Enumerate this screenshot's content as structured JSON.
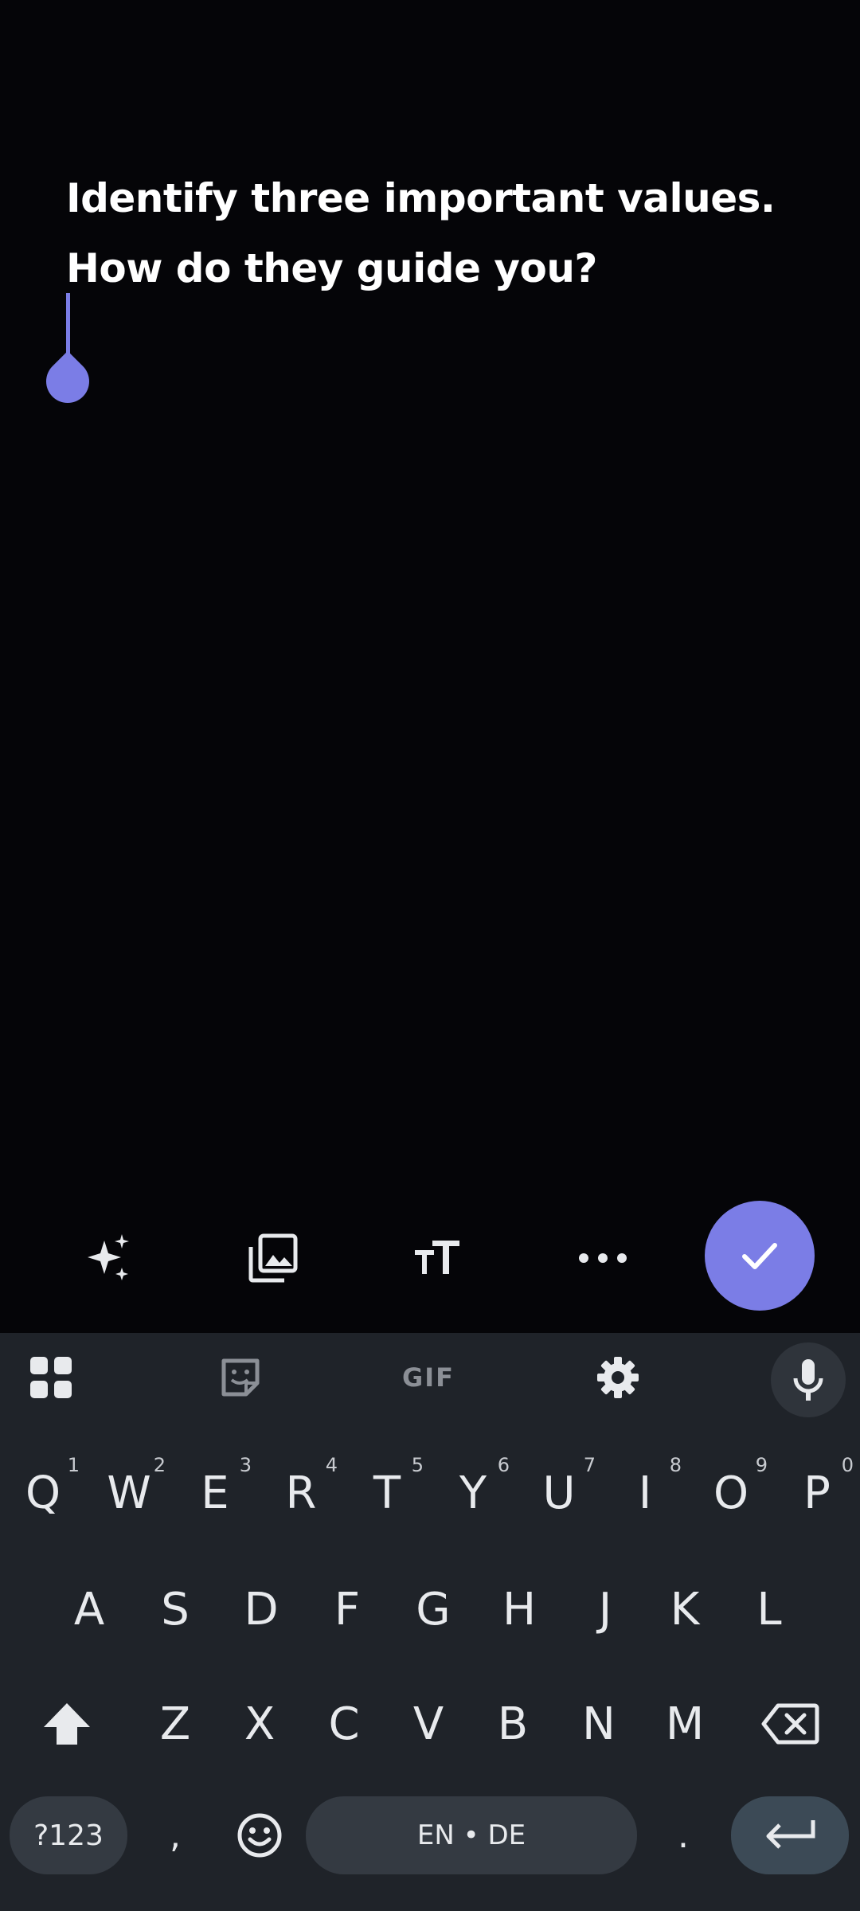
{
  "editor": {
    "prompt_line1": "Identify three important values.",
    "prompt_line2": "How do they guide you?",
    "accent_color": "#7b7de6"
  },
  "toolbar": {
    "tools": [
      "sparkle-icon",
      "photo-gallery-icon",
      "text-size-icon",
      "more-horizontal-icon"
    ],
    "confirm_icon": "checkmark-icon"
  },
  "keyboard": {
    "top_tools": [
      "apps-grid-icon",
      "sticker-icon",
      "GIF",
      "settings-gear-icon",
      "microphone-icon"
    ],
    "gif_label": "GIF",
    "row1": [
      {
        "key": "Q",
        "hint": "1"
      },
      {
        "key": "W",
        "hint": "2"
      },
      {
        "key": "E",
        "hint": "3"
      },
      {
        "key": "R",
        "hint": "4"
      },
      {
        "key": "T",
        "hint": "5"
      },
      {
        "key": "Y",
        "hint": "6"
      },
      {
        "key": "U",
        "hint": "7"
      },
      {
        "key": "I",
        "hint": "8"
      },
      {
        "key": "O",
        "hint": "9"
      },
      {
        "key": "P",
        "hint": "0"
      }
    ],
    "row2": [
      "A",
      "S",
      "D",
      "F",
      "G",
      "H",
      "J",
      "K",
      "L"
    ],
    "row3": [
      "Z",
      "X",
      "C",
      "V",
      "B",
      "N",
      "M"
    ],
    "symbols_label": "?123",
    "comma_label": ",",
    "space_label": "EN • DE",
    "period_label": "."
  }
}
